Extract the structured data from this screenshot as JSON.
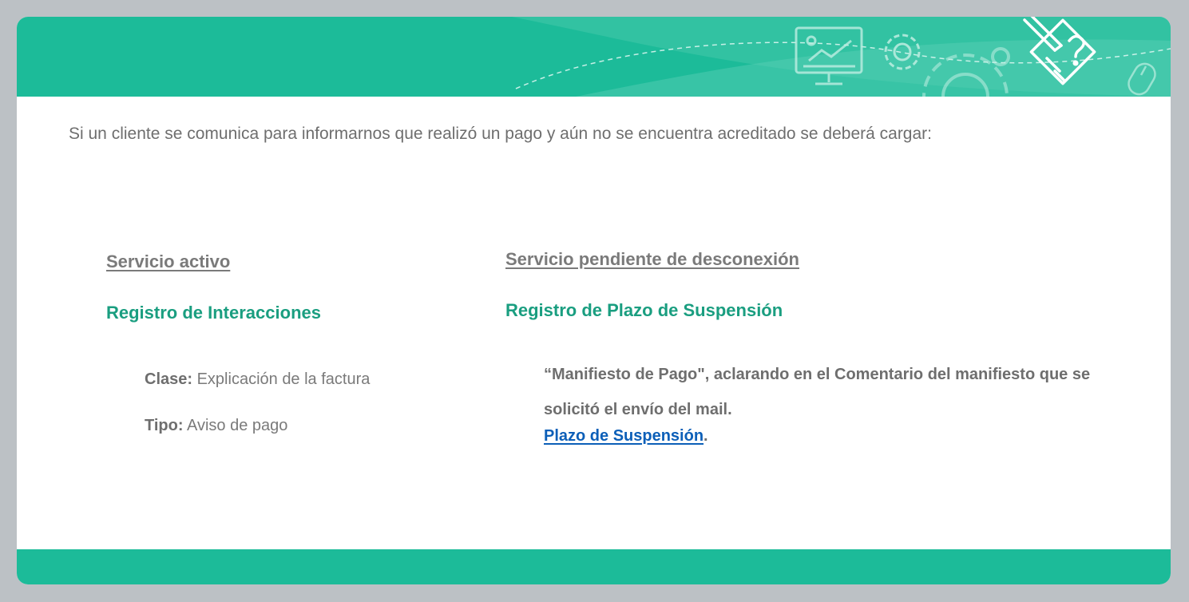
{
  "intro_text": "Si un cliente se comunica para informarnos que realizó un pago y aún no se encuentra acreditado se deberá cargar:",
  "left_column": {
    "heading": "Servicio activo",
    "section_title": "Registro de Interacciones",
    "clase_label": "Clase:",
    "clase_value": "Explicación de la factura",
    "tipo_label": "Tipo:",
    "tipo_value": "Aviso de pago"
  },
  "right_column": {
    "heading": "Servicio pendiente de desconexión",
    "section_title": "Registro de Plazo de Suspensión",
    "manifest_text": "“Manifiesto de Pago\", aclarando en el Comentario del manifiesto que se solicitó el envío del mail.",
    "link_text": "Plazo de Suspensión",
    "link_suffix": "."
  },
  "colors": {
    "band": "#1cbb99",
    "accent_text": "#1a9e80",
    "link": "#0c5fb8",
    "body_text": "#6e6e6e",
    "page_bg": "#bcc1c5"
  },
  "header_icons": [
    "monitor-presentation-icon",
    "gear-icon",
    "large-gear-icon",
    "pencil-question-icon",
    "mouse-icon"
  ]
}
